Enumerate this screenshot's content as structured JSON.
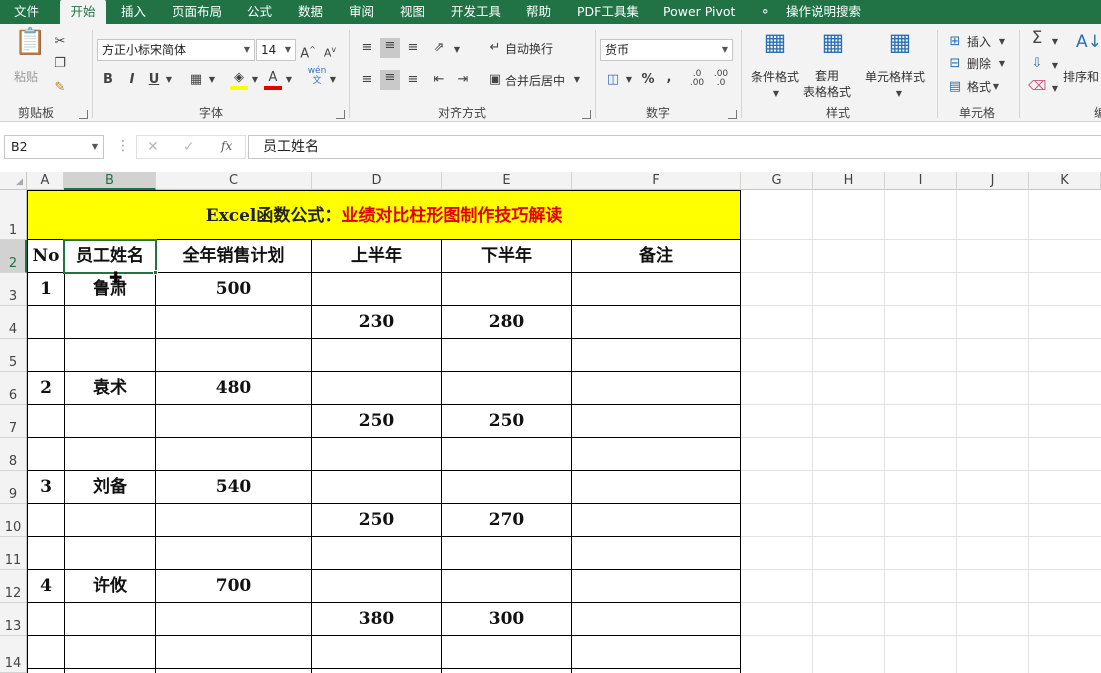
{
  "tabs": [
    "文件",
    "开始",
    "插入",
    "页面布局",
    "公式",
    "数据",
    "审阅",
    "视图",
    "开发工具",
    "帮助",
    "PDF工具集",
    "Power Pivot",
    "操作说明搜索"
  ],
  "ribbon": {
    "clipboard": {
      "paste": "粘贴",
      "label": "剪贴板"
    },
    "font": {
      "name": "方正小标宋简体",
      "size": "14",
      "label": "字体",
      "bold": "B",
      "italic": "I",
      "underline": "U",
      "wen": "wén\n文"
    },
    "align": {
      "wrap": "自动换行",
      "merge": "合并后居中",
      "label": "对齐方式"
    },
    "number": {
      "format": "货币",
      "label": "数字",
      "percent": "%",
      "comma": ","
    },
    "styles": {
      "cond": "条件格式",
      "table": "套用\n表格格式",
      "cell": "单元格样式",
      "label": "样式"
    },
    "cells": {
      "insert": "插入",
      "delete": "删除",
      "format": "格式",
      "label": "单元格"
    },
    "editing": {
      "sort": "排序和",
      "label": "编"
    }
  },
  "formula_bar": {
    "name_box": "B2",
    "content": "员工姓名",
    "fx": "fx"
  },
  "columns": [
    "A",
    "B",
    "C",
    "D",
    "E",
    "F",
    "G",
    "H",
    "I",
    "J",
    "K"
  ],
  "rows": [
    "1",
    "2",
    "3",
    "4",
    "5",
    "6",
    "7",
    "8",
    "9",
    "10",
    "11",
    "12",
    "13",
    "14"
  ],
  "sheet": {
    "title_black": "Excel函数公式：",
    "title_red": "业绩对比柱形图制作技巧解读",
    "headers": [
      "No",
      "员工姓名",
      "全年销售计划",
      "上半年",
      "下半年",
      "备注"
    ],
    "cells": [
      {
        "r": 3,
        "c": "A",
        "v": "1"
      },
      {
        "r": 3,
        "c": "B",
        "v": "鲁肃"
      },
      {
        "r": 3,
        "c": "C",
        "v": "500"
      },
      {
        "r": 4,
        "c": "D",
        "v": "230"
      },
      {
        "r": 4,
        "c": "E",
        "v": "280"
      },
      {
        "r": 6,
        "c": "A",
        "v": "2"
      },
      {
        "r": 6,
        "c": "B",
        "v": "袁术"
      },
      {
        "r": 6,
        "c": "C",
        "v": "480"
      },
      {
        "r": 7,
        "c": "D",
        "v": "250"
      },
      {
        "r": 7,
        "c": "E",
        "v": "250"
      },
      {
        "r": 9,
        "c": "A",
        "v": "3"
      },
      {
        "r": 9,
        "c": "B",
        "v": "刘备"
      },
      {
        "r": 9,
        "c": "C",
        "v": "540"
      },
      {
        "r": 10,
        "c": "D",
        "v": "250"
      },
      {
        "r": 10,
        "c": "E",
        "v": "270"
      },
      {
        "r": 12,
        "c": "A",
        "v": "4"
      },
      {
        "r": 12,
        "c": "B",
        "v": "许攸"
      },
      {
        "r": 12,
        "c": "C",
        "v": "700"
      },
      {
        "r": 13,
        "c": "D",
        "v": "380"
      },
      {
        "r": 13,
        "c": "E",
        "v": "300"
      }
    ]
  },
  "colors": {
    "accent": "#217346",
    "title_fill": "#ffff00",
    "title_red": "#e00000"
  }
}
